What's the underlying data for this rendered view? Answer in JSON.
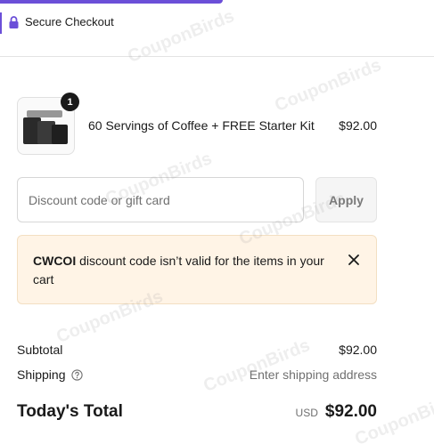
{
  "header": {
    "secure_label": "Secure Checkout",
    "accent_color": "#6b4fd8"
  },
  "cart": {
    "items": [
      {
        "quantity": "1",
        "name": "60 Servings of Coffee + FREE Starter Kit",
        "price": "$92.00",
        "thumbnail_icon": "coffee-kit-image"
      }
    ]
  },
  "discount": {
    "placeholder": "Discount code or gift card",
    "value": "",
    "apply_label": "Apply"
  },
  "error": {
    "code": "CWCOI",
    "message": " discount code isn’t valid for the items in your cart",
    "background": "#fff4e6"
  },
  "summary": {
    "subtotal_label": "Subtotal",
    "subtotal_value": "$92.00",
    "shipping_label": "Shipping",
    "shipping_value": "Enter shipping address",
    "total_label": "Today's Total",
    "currency": "USD",
    "total_value": "$92.00"
  },
  "watermark": {
    "text": "CouponBirds"
  }
}
